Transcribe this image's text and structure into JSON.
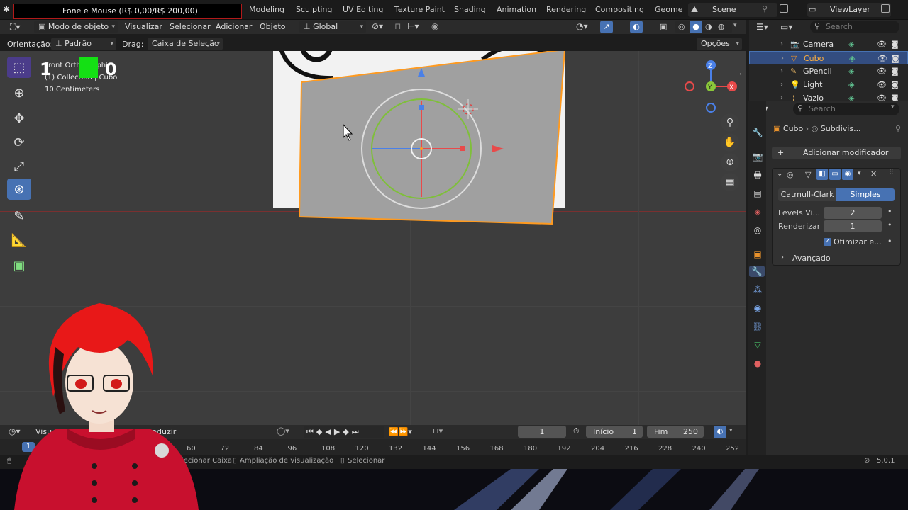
{
  "overlay": {
    "banner_text": "Fone e Mouse (R$ 0,00/R$ 200,00)"
  },
  "workspaces": [
    "Modeling",
    "Sculpting",
    "UV Editing",
    "Texture Paint",
    "Shading",
    "Animation",
    "Rendering",
    "Compositing",
    "Geome"
  ],
  "scene": {
    "name": "Scene",
    "view_layer": "ViewLayer"
  },
  "header": {
    "mode": "Modo de objeto",
    "menus": [
      "Visualizar",
      "Selecionar",
      "Adicionar",
      "Objeto"
    ],
    "transform_orientation": "Global"
  },
  "tool_header": {
    "orientation_label": "Orientação:",
    "orientation_value": "Padrão",
    "drag_label": "Drag:",
    "drag_value": "Caixa de Seleção",
    "options": "Opções"
  },
  "viewport_info": {
    "line1": "Front Orthographic",
    "line2": "(1) Collection | Cubo",
    "line3": "10 Centimeters",
    "overlay_counter_left": "1",
    "overlay_counter_right": "0"
  },
  "outliner": {
    "search_placeholder": "Search",
    "items": [
      {
        "name": "Camera",
        "color": "#d7a95e"
      },
      {
        "name": "Cubo",
        "color": "#e8912b"
      },
      {
        "name": "GPencil",
        "color": "#d7a95e"
      },
      {
        "name": "Light",
        "color": "#d7a95e"
      },
      {
        "name": "Vazio",
        "color": "#d7a95e"
      }
    ]
  },
  "properties": {
    "search_placeholder": "Search",
    "breadcrumb_object": "Cubo",
    "breadcrumb_modifier": "Subdivis...",
    "add_modifier": "Adicionar modificador",
    "modifier": {
      "tab_catmull": "Catmull-Clark",
      "tab_simple": "Simples",
      "levels_label": "Levels Vi...",
      "levels_value": "2",
      "render_label": "Renderizar",
      "render_value": "1",
      "optimize_label": "Otimizar e...",
      "advanced_label": "Avançado"
    }
  },
  "timeline": {
    "menu_view": "Visu",
    "menu_playback": "roduzir",
    "current_frame": "1",
    "start_label": "Início",
    "start_value": "1",
    "end_label": "Fim",
    "end_value": "250",
    "frame_indicator": "1",
    "ticks": [
      "60",
      "72",
      "84",
      "96",
      "108",
      "120",
      "132",
      "144",
      "156",
      "168",
      "180",
      "192",
      "204",
      "216",
      "228",
      "240",
      "252"
    ]
  },
  "statusbar": {
    "hint1": "lecionar Caixa",
    "hint2": "Ampliação de visualização",
    "hint3": "Selecionar",
    "version": "5.0.1"
  },
  "colors": {
    "accent_blue": "#4772b3",
    "selection_orange": "#ff9a1f",
    "hair_red": "#e81818",
    "coat_red": "#c8102e"
  }
}
